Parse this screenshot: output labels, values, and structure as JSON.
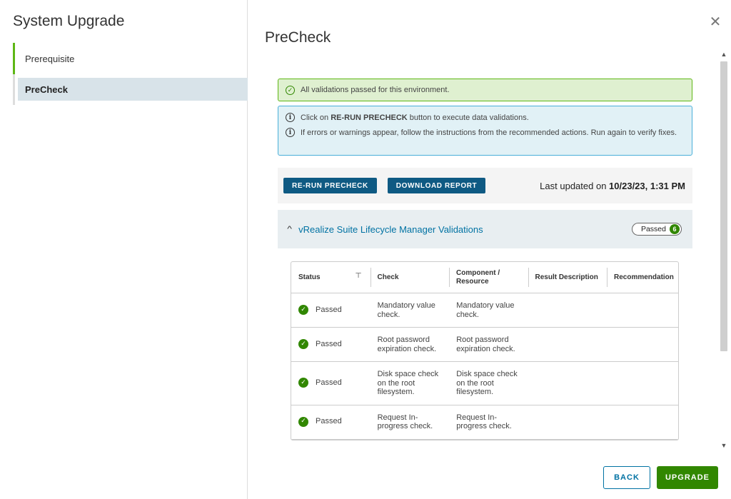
{
  "sidebar": {
    "title": "System Upgrade",
    "steps": [
      {
        "label": "Prerequisite"
      },
      {
        "label": "PreCheck"
      }
    ]
  },
  "main": {
    "title": "PreCheck",
    "close_icon": "close-icon"
  },
  "alerts": {
    "success": "All validations passed for this environment.",
    "info_1_pre": "Click on ",
    "info_1_bold": "RE-RUN PRECHECK",
    "info_1_post": " button to execute data validations.",
    "info_2": "If errors or warnings appear, follow the instructions from the recommended actions. Run again to verify fixes."
  },
  "toolbar": {
    "rerun_label": "RE-RUN PRECHECK",
    "download_label": "DOWNLOAD REPORT",
    "last_updated_prefix": "Last updated on ",
    "last_updated_value": "10/23/23, 1:31 PM"
  },
  "accordion": {
    "title": "vRealize Suite Lifecycle Manager Validations",
    "badge_label": "Passed",
    "badge_count": "6"
  },
  "table": {
    "headers": [
      "Status",
      "Check",
      "Component / Resource",
      "Result Description",
      "Recommendation"
    ],
    "rows": [
      {
        "status": "Passed",
        "check": "Mandatory value check.",
        "component": "Mandatory value check.",
        "result": "",
        "recommendation": ""
      },
      {
        "status": "Passed",
        "check": "Root password expiration check.",
        "component": "Root password expiration check.",
        "result": "",
        "recommendation": ""
      },
      {
        "status": "Passed",
        "check": "Disk space check on the root filesystem.",
        "component": "Disk space check on the root filesystem.",
        "result": "",
        "recommendation": ""
      },
      {
        "status": "Passed",
        "check": "Request In-progress check.",
        "component": "Request In-progress check.",
        "result": "",
        "recommendation": ""
      }
    ]
  },
  "footer": {
    "back_label": "BACK",
    "upgrade_label": "UPGRADE"
  },
  "colors": {
    "success": "#318700",
    "primary": "#0f5a83",
    "link": "#0072a3"
  }
}
